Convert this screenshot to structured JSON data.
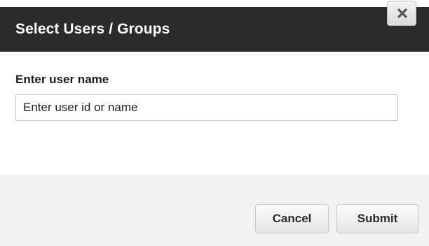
{
  "dialog": {
    "title": "Select Users / Groups",
    "close_icon": "close-icon"
  },
  "form": {
    "label": "Enter user name",
    "input_value": "",
    "input_placeholder": "Enter user id or name"
  },
  "actions": {
    "cancel_label": "Cancel",
    "submit_label": "Submit"
  },
  "colors": {
    "header_bg": "#2b2b2b",
    "header_text": "#ffffff",
    "footer_bg": "#f2f2f2"
  }
}
